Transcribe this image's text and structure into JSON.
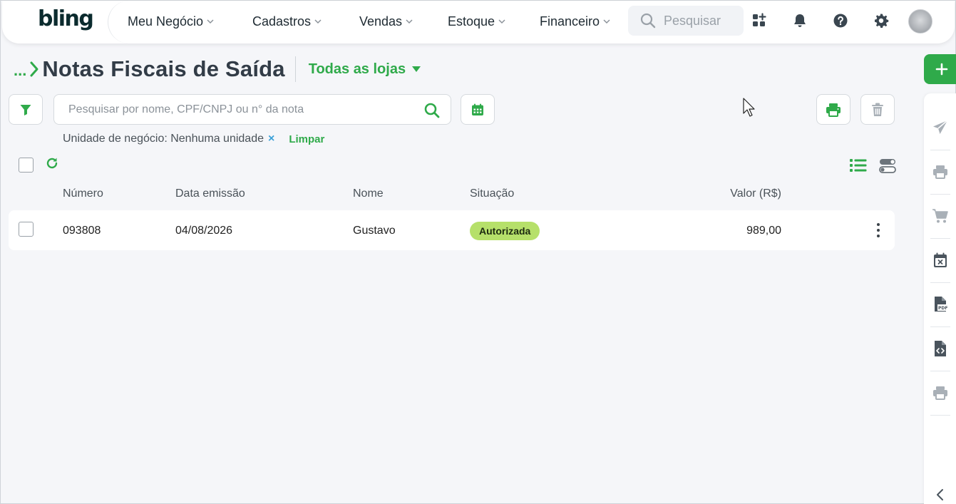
{
  "app": {
    "logo": "bling"
  },
  "nav": {
    "items": [
      {
        "label": "Meu Negócio"
      },
      {
        "label": "Cadastros"
      },
      {
        "label": "Vendas"
      },
      {
        "label": "Estoque"
      },
      {
        "label": "Financeiro"
      }
    ],
    "search_placeholder": "Pesquisar"
  },
  "page": {
    "breadcrumb_ellipsis": "...",
    "title": "Notas Fiscais de Saída",
    "store_selector": "Todas as lojas"
  },
  "toolbar": {
    "search_placeholder": "Pesquisar por nome, CPF/CNPJ ou n° da nota"
  },
  "filters": {
    "active_label": "Unidade de negócio: Nenhuma unidade",
    "remove_symbol": "×",
    "clear_label": "Limpar"
  },
  "table": {
    "columns": {
      "numero": "Número",
      "data": "Data emissão",
      "nome": "Nome",
      "situacao": "Situação",
      "valor": "Valor (R$)"
    },
    "rows": [
      {
        "numero": "093808",
        "data": "04/08/2026",
        "nome": "Gustavo",
        "situacao": "Autorizada",
        "valor": "989,00"
      }
    ]
  },
  "colors": {
    "accent_green": "#2faa4a",
    "badge_green": "#b6e06a",
    "title": "#323c47",
    "side_icon": "#a9b0b7"
  },
  "icons": {
    "top": [
      "apps-icon",
      "bell-icon",
      "help-icon",
      "gear-icon"
    ],
    "side": [
      "send-icon",
      "printer-icon",
      "cart-icon",
      "calendar-x-icon",
      "pdf-file-icon",
      "code-file-icon",
      "printer-icon",
      "chevron-left-icon"
    ]
  }
}
